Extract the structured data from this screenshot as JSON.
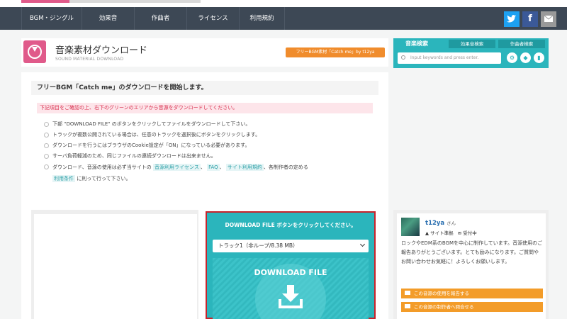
{
  "nav": {
    "items": [
      "BGM・ジングル",
      "効果音",
      "作曲者",
      "ライセンス",
      "利用規約"
    ]
  },
  "social": {
    "twitter_icon": "twitter-icon",
    "facebook_label": "f",
    "mail_icon": "mail-icon",
    "twitter_color": "#1da1f2",
    "facebook_color": "#3b5998",
    "mail_color": "#999999"
  },
  "header": {
    "title": "音楽素材ダウンロード",
    "subtitle": "SOUND MATERIAL DOWNLOAD",
    "tag": "フリーBGM素材「Catch me」by t12ya"
  },
  "search": {
    "tabs": [
      "音楽検索",
      "効果音検索",
      "作曲者検索"
    ],
    "placeholder": "Input keywords and press enter.",
    "icons": [
      "gear-icon",
      "tag-icon",
      "trash-icon"
    ]
  },
  "main": {
    "title": "フリーBGM「Catch me」のダウンロードを開始します。",
    "notice": "下記項目をご確認の上、右下のグリーンのエリアから音源をダウンロードしてください。",
    "bullets": [
      "下部 \"DOWNLOAD FILE\" のボタンをクリックしてファイルをダウンロードして下さい。",
      "トラックが複数公開されている場合は、任意のトラックを選択後にボタンをクリックします。",
      "ダウンロードを行うにはブラウザのCookie設定が「ON」になっている必要があります。",
      "サーバ負荷軽減のため、同じファイルの連続ダウンロードは出来ません。"
    ],
    "last_bullet": {
      "pre": "ダウンロード、音源の使用は必ず当サイトの",
      "link1": "音源利用ライセンス",
      "sep1": "、",
      "link2": "FAQ",
      "sep2": "、",
      "link3": "サイト利用規約",
      "mid": "、各制作者の定める",
      "link4": "利用条件",
      "post": "に則って行って下さい。"
    }
  },
  "download": {
    "heading": "DOWNLOAD FILE ボタンをクリックしてください。",
    "track_selected": "トラック1（非ループ/8.38 MB）",
    "button_label": "DOWNLOAD FILE"
  },
  "profile": {
    "name": "t12ya",
    "honorific": "さん",
    "meta1": "▲ サイト準拠",
    "meta2": "✉ 受付中",
    "description": "ロックやEDM系のBGMを中心に制作しています。音源使用のご報告ありがとうございます。とても励みになります。ご質問やお問い合わせお気軽に！よろしくお願いします。",
    "button1": "この音源の使用を報告する",
    "button2": "この音源の制作者へ問合せる"
  },
  "colors": {
    "nav_bg": "#3d4855",
    "brand_pink": "#e05a8a",
    "teal": "#2bb5bc",
    "orange": "#f39c29",
    "notice_red": "#d9304f",
    "highlight_border": "#c8232b"
  }
}
